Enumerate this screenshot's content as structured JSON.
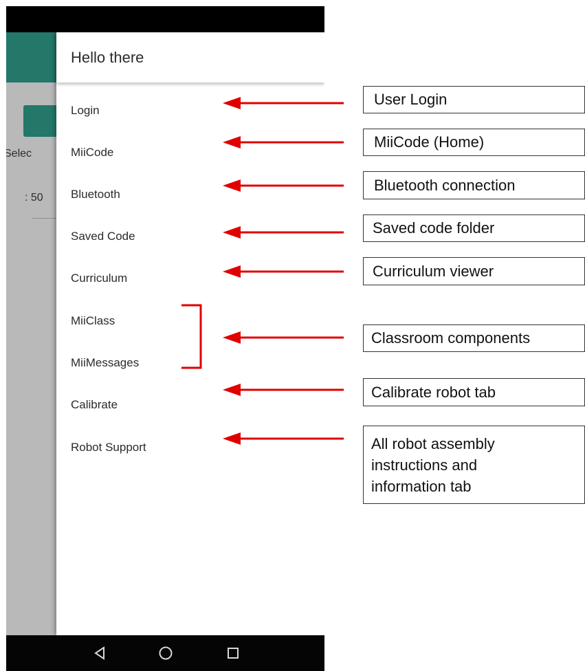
{
  "background_app": {
    "partial_label_select": "Selec",
    "partial_label_value": ": 50"
  },
  "drawer": {
    "header_title": "Hello there",
    "items": [
      {
        "label": "Login"
      },
      {
        "label": "MiiCode"
      },
      {
        "label": "Bluetooth"
      },
      {
        "label": "Saved Code"
      },
      {
        "label": "Curriculum"
      },
      {
        "label": "MiiClass"
      },
      {
        "label": "MiiMessages"
      },
      {
        "label": "Calibrate"
      },
      {
        "label": "Robot Support"
      }
    ]
  },
  "navbar": {
    "back_icon": "back-triangle-icon",
    "home_icon": "home-circle-icon",
    "recents_icon": "recents-square-icon"
  },
  "annotations": {
    "user_login": "User Login",
    "miicode_home": "MiiCode (Home)",
    "bluetooth_connection": "Bluetooth connection",
    "saved_code_folder": "Saved code folder",
    "curriculum_viewer": "Curriculum viewer",
    "classroom_components": "Classroom components",
    "calibrate_robot_tab": "Calibrate robot tab",
    "robot_support_line1": "All robot assembly",
    "robot_support_line2": "instructions and",
    "robot_support_line3": "information tab"
  },
  "colors": {
    "app_bar": "#23786a",
    "annotation_arrow": "#e00000",
    "scrim": "#b9b9b9"
  }
}
